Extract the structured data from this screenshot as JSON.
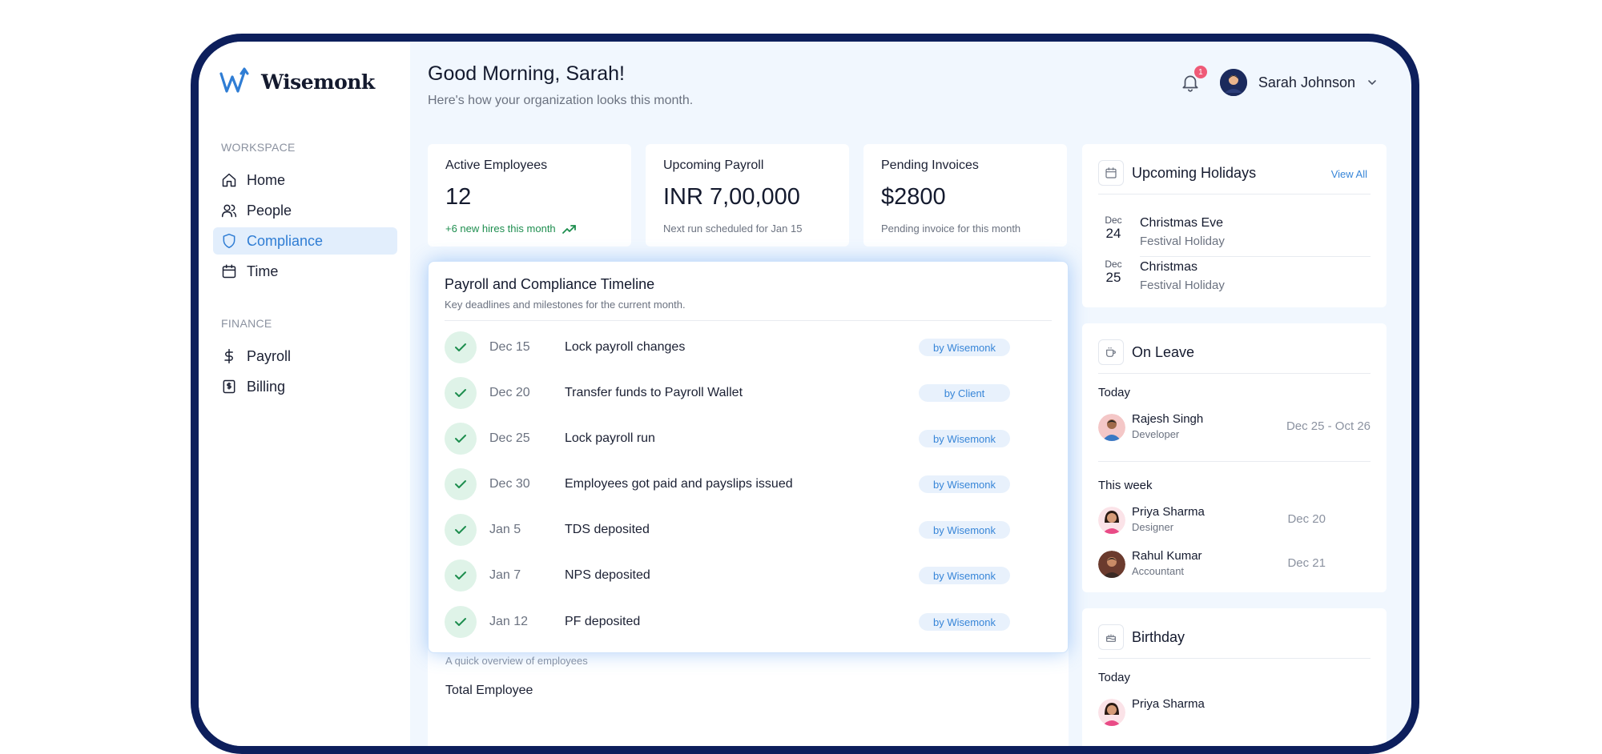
{
  "app": {
    "name": "Wisemonk"
  },
  "sidebar": {
    "sections": [
      {
        "label": "WORKSPACE"
      },
      {
        "label": "FINANCE"
      }
    ],
    "items": [
      {
        "label": "Home",
        "icon": "home-icon"
      },
      {
        "label": "People",
        "icon": "people-icon"
      },
      {
        "label": "Compliance",
        "icon": "shield-icon",
        "active": true
      },
      {
        "label": "Time",
        "icon": "calendar-icon"
      },
      {
        "label": "Payroll",
        "icon": "dollar-icon"
      },
      {
        "label": "Billing",
        "icon": "receipt-icon"
      }
    ]
  },
  "header": {
    "greeting": "Good Morning, Sarah!",
    "subtitle": "Here's how your organization looks this month.",
    "notifications_count": "1",
    "user_name": "Sarah Johnson"
  },
  "stats": [
    {
      "title": "Active Employees",
      "value": "12",
      "foot": "+6 new hires this month"
    },
    {
      "title": "Upcoming Payroll",
      "value": "INR 7,00,000",
      "foot": "Next run scheduled for Jan 15"
    },
    {
      "title": "Pending Invoices",
      "value": "$2800",
      "foot": "Pending invoice for this month"
    }
  ],
  "timeline": {
    "title": "Payroll and Compliance Timeline",
    "subtitle": "Key deadlines and milestones for the current month.",
    "rows": [
      {
        "date": "Dec 15",
        "text": "Lock payroll changes",
        "badge": "by Wisemonk"
      },
      {
        "date": "Dec 20",
        "text": "Transfer funds to Payroll Wallet",
        "badge": "by Client"
      },
      {
        "date": "Dec 25",
        "text": "Lock payroll run",
        "badge": "by Wisemonk"
      },
      {
        "date": "Dec 30",
        "text": "Employees got paid and payslips issued",
        "badge": "by Wisemonk"
      },
      {
        "date": "Jan 5",
        "text": "TDS deposited",
        "badge": "by Wisemonk"
      },
      {
        "date": "Jan 7",
        "text": "NPS deposited",
        "badge": "by Wisemonk"
      },
      {
        "date": "Jan 12",
        "text": "PF deposited",
        "badge": "by Wisemonk"
      }
    ]
  },
  "overview": {
    "subtitle": "A quick overview of employees",
    "title": "Total Employee"
  },
  "holidays": {
    "title": "Upcoming Holidays",
    "link": "View All",
    "items": [
      {
        "month": "Dec",
        "day": "24",
        "name": "Christmas Eve",
        "type": "Festival Holiday"
      },
      {
        "month": "Dec",
        "day": "25",
        "name": "Christmas",
        "type": "Festival Holiday"
      }
    ]
  },
  "on_leave": {
    "title": "On Leave",
    "today_label": "Today",
    "week_label": "This week",
    "today": [
      {
        "name": "Rajesh Singh",
        "role": "Developer",
        "range": "Dec 25 - Oct 26"
      }
    ],
    "week": [
      {
        "name": "Priya Sharma",
        "role": "Designer",
        "range": "Dec 20"
      },
      {
        "name": "Rahul Kumar",
        "role": "Accountant",
        "range": "Dec 21"
      }
    ]
  },
  "birthday": {
    "title": "Birthday",
    "today_label": "Today",
    "today": [
      {
        "name": "Priya Sharma"
      }
    ]
  },
  "colors": {
    "accent": "#2f7dd4",
    "frame": "#0d1f5c",
    "success": "#1e8e4f",
    "badge_bg": "#e8f1fc",
    "notification": "#ef5a77"
  }
}
